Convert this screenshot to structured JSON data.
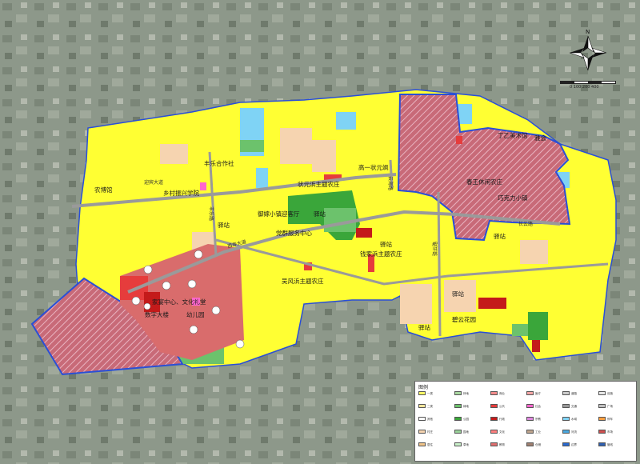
{
  "compass": {
    "north_label": "N"
  },
  "scale": {
    "label": "0   100   200   400"
  },
  "labels": {
    "nongbo": "农博馆",
    "xiangcun": "乡村振兴学院",
    "fengle": "丰乐合作社",
    "yangao": "高一状元飒",
    "zhuangyuan": "状元浜主题农庄",
    "yuhu": "御嫁小镇迎客厅",
    "dangqun": "党群服务中心",
    "yizhan1": "驿站",
    "qianjiabang": "钱家浜主题农庄",
    "wufeng": "吴风浜主题农庄",
    "jiayan": "家宴中心、文化礼堂",
    "shuzi": "数字大楼",
    "youer": "幼儿园",
    "dingyi": "丁乙美术馆",
    "wenhui": "雅会",
    "chunwang": "春王休闲农庄",
    "qiaoke": "巧克力小镇",
    "yizhan2": "驿站",
    "yizhan3": "驿站",
    "yizhan4": "驿站",
    "yizhan5": "驿站",
    "biyun": "碧云花园",
    "yizhan6": "驿站"
  },
  "roads": {
    "r1": "迎宾大道",
    "r2": "丰乐路",
    "r3": "西寿大道",
    "r4": "云海路",
    "r5": "长云路",
    "r6": "驿云路"
  },
  "legend": {
    "title": "图例",
    "items": [
      {
        "color": "#ffff66",
        "label": "一类"
      },
      {
        "color": "#f5e69c",
        "label": "二类"
      },
      {
        "color": "#ffffff",
        "label": "其他"
      },
      {
        "color": "#f6d4b0",
        "label": "村庄"
      },
      {
        "color": "#f0c48a",
        "label": "居住"
      },
      {
        "color": "#a8d8a0",
        "label": "林地"
      },
      {
        "color": "#6cc26c",
        "label": "绿地"
      },
      {
        "color": "#3aa63a",
        "label": "公园"
      },
      {
        "color": "#9ad29a",
        "label": "园地"
      },
      {
        "color": "#c9f0c9",
        "label": "草地"
      },
      {
        "color": "#f28c8c",
        "label": "商业"
      },
      {
        "color": "#e63c3c",
        "label": "公共"
      },
      {
        "color": "#c41a1a",
        "label": "行政"
      },
      {
        "color": "#ff8080",
        "label": "文化"
      },
      {
        "color": "#e07070",
        "label": "教育"
      },
      {
        "color": "#f4a6a6",
        "label": "医疗"
      },
      {
        "color": "#ff66cc",
        "label": "社会"
      },
      {
        "color": "#dd88dd",
        "label": "宗教"
      },
      {
        "color": "#bfa58f",
        "label": "工业"
      },
      {
        "color": "#a08070",
        "label": "仓储"
      },
      {
        "color": "#cccccc",
        "label": "道路"
      },
      {
        "color": "#999999",
        "label": "交通"
      },
      {
        "color": "#7fd3f5",
        "label": "水域"
      },
      {
        "color": "#4aa8e0",
        "label": "河流"
      },
      {
        "color": "#2a6ad0",
        "label": "边界"
      },
      {
        "color": "#e8e8e8",
        "label": "设施"
      },
      {
        "color": "#c0c0c0",
        "label": "广场"
      },
      {
        "color": "#ff9f40",
        "label": "停车"
      },
      {
        "color": "#d05050",
        "label": "市场"
      },
      {
        "color": "#3060b0",
        "label": "管线"
      }
    ]
  },
  "colors": {
    "yellow": "#ffff33",
    "village": "#f6d4b0",
    "green": "#3aa63a",
    "water": "#7fd3f5",
    "red": "#e63c3c",
    "salmon": "#d96c6c",
    "boundary": "#2a4fd6"
  }
}
